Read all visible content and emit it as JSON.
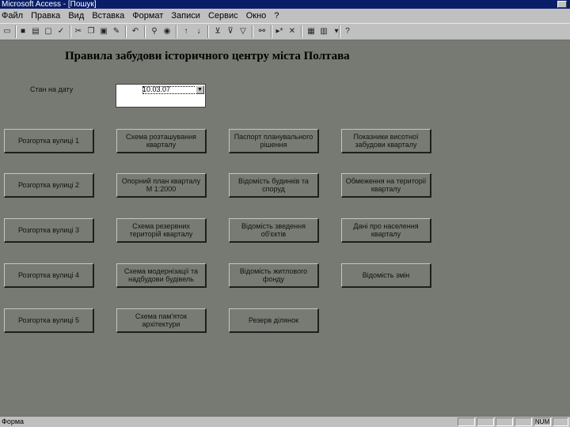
{
  "window": {
    "title": "Microsoft Access - [Пошук]"
  },
  "menu": [
    "Файл",
    "Правка",
    "Вид",
    "Вставка",
    "Формат",
    "Записи",
    "Сервис",
    "Окно",
    "?"
  ],
  "toolbar": {
    "icons": [
      "form-view-icon",
      "save-icon",
      "print-icon",
      "print-preview-icon",
      "spelling-icon",
      "cut-icon",
      "copy-icon",
      "paste-icon",
      "format-painter-icon",
      "undo-icon",
      "insert-hyperlink-icon",
      "web-toolbar-icon",
      "sort-ascending-icon",
      "sort-descending-icon",
      "filter-by-selection-icon",
      "filter-by-form-icon",
      "apply-filter-icon",
      "find-icon",
      "new-record-icon",
      "delete-record-icon",
      "properties-icon",
      "database-window-icon",
      "new-object-icon",
      "help-icon"
    ]
  },
  "form": {
    "title": "Правила забудови історичного центру міста Полтава",
    "date_label": "Стан на дату",
    "date_value": "10.03.07",
    "buttons": [
      "Розгортка вулиці 1",
      "Схема розташування кварталу",
      "Паспорт планувального рішення",
      "Показники висотної забудови кварталу",
      "Розгортка вулиці 2",
      "Опорний план кварталу М 1:2000",
      "Відомість будинків та споруд",
      "Обмеження на території кварталу",
      "Розгортка вулиці 3",
      "Схема резервних територій кварталу",
      "Відомість зведення об'єктів",
      "Дані про населення кварталу",
      "Розгортка вулиці 4",
      "Схема модернізації та надбудови будівель",
      "Відомість житлового фонду",
      "Відомість змін",
      "Розгортка вулиці 5",
      "Схема пам'яток архітектури",
      "Резерв ділянок"
    ]
  },
  "status": {
    "text": "Форма",
    "indicator": "NUM"
  }
}
